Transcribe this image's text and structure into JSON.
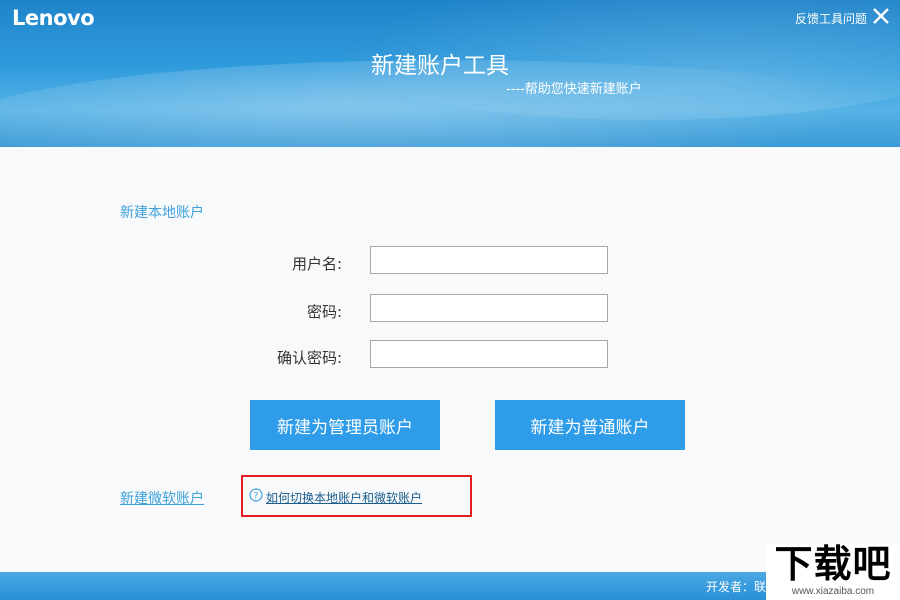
{
  "header": {
    "logo": "Lenovo",
    "feedback": "反馈工具问题",
    "title": "新建账户工具",
    "subtitle": "----帮助您快速新建账户"
  },
  "form": {
    "section_title": "新建本地账户",
    "username_label": "用户名:",
    "password_label": "密码:",
    "confirm_label": "确认密码:",
    "username_value": "",
    "password_value": "",
    "confirm_value": ""
  },
  "buttons": {
    "admin": "新建为管理员账户",
    "standard": "新建为普通账户"
  },
  "links": {
    "microsoft_account": "新建微软账户",
    "how_to_switch": "如何切换本地账户和微软账户"
  },
  "footer": {
    "developer": "开发者：联"
  },
  "watermark": {
    "text": "下载吧",
    "url": "www.xiazaiba.com"
  },
  "colors": {
    "accent": "#2e9ce8",
    "link": "#3ea1dc",
    "highlight": "#e21e1e"
  }
}
